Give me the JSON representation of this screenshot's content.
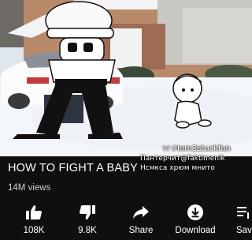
{
  "video": {
    "watermark_line1": "тг:Hom3stuckfan",
    "watermark_line2": "Пантерчит@faktimenik",
    "watermark_line3": "Нсмкса хрюм мнито"
  },
  "title": "HOW TO FIGHT A BABY",
  "views": "14M views",
  "actions": {
    "like_count": "108K",
    "dislike_count": "9.8K",
    "share_label": "Share",
    "download_label": "Download",
    "save_label": "Sav"
  },
  "colors": {
    "background": "#0f0f0f",
    "text": "#ffffff",
    "subtext": "#cfcfcf"
  },
  "icons": [
    "like-icon",
    "dislike-icon",
    "share-icon",
    "download-icon",
    "save-icon"
  ]
}
